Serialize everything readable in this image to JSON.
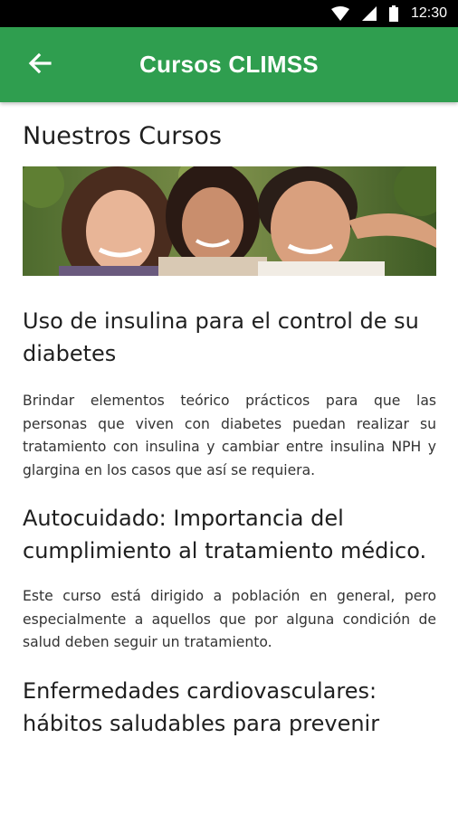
{
  "status_bar": {
    "time": "12:30",
    "icons": [
      "wifi-icon",
      "signal-icon",
      "battery-icon"
    ]
  },
  "app_bar": {
    "title": "Cursos CLIMSS",
    "back_icon": "arrow-left-icon",
    "color": "#2f9e4f"
  },
  "section": {
    "title": "Nuestros Cursos"
  },
  "courses": [
    {
      "title": "Uso de insulina para el control de su diabetes",
      "description": "Brindar elementos teórico prácticos para que las personas que viven con diabetes puedan realizar su tratamiento con insulina y cambiar entre insulina NPH y glargina en los casos que así se requiera."
    },
    {
      "title": "Autocuidado: Importancia del cumplimiento al tratamiento médico.",
      "description": "Este curso está dirigido a población en general, pero especialmente a aquellos que por alguna condición de salud deben seguir un tratamiento."
    },
    {
      "title": "Enfermedades cardiovasculares: hábitos saludables para prevenir"
    }
  ]
}
